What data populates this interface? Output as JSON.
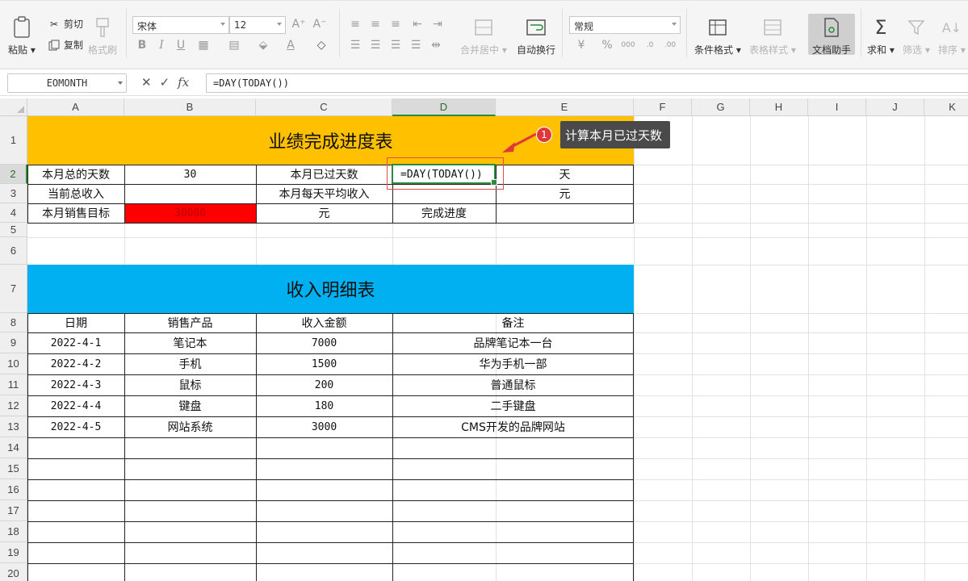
{
  "ribbon": {
    "clipboard": {
      "paste": "粘贴",
      "cut": "剪切",
      "copy": "复制",
      "format_painter": "格式刷"
    },
    "font": {
      "name": "宋体",
      "size": "12",
      "bold": "B",
      "italic": "I",
      "underline": "U"
    },
    "merge_center": "合并居中",
    "wrap_text": "自动换行",
    "number_format": "常规",
    "conditional_format": "条件格式",
    "table_style": "表格样式",
    "doc_assistant": "文档助手",
    "sum": "求和",
    "filter": "筛选",
    "sort": "排序"
  },
  "formula_bar": {
    "name_box": "EOMONTH",
    "fx_label": "fx",
    "formula": "=DAY(TODAY())"
  },
  "columns": [
    "A",
    "B",
    "C",
    "D",
    "E",
    "F",
    "G",
    "H",
    "I",
    "J",
    "K"
  ],
  "rows": [
    "1",
    "2",
    "3",
    "4",
    "5",
    "6",
    "7",
    "8",
    "9",
    "10",
    "11",
    "12",
    "13",
    "14",
    "15",
    "16",
    "17",
    "18",
    "19",
    "20"
  ],
  "sheet": {
    "title1": "业绩完成进度表",
    "r2": {
      "a": "本月总的天数",
      "b": "30",
      "c": "本月已过天数",
      "d": "=DAY(TODAY())",
      "e": "天"
    },
    "r3": {
      "a": "当前总收入",
      "c": "本月每天平均收入",
      "e": "元"
    },
    "r4": {
      "a": "本月销售目标",
      "b": "30000",
      "c": "元",
      "d": "完成进度"
    },
    "title2": "收入明细表",
    "detail_headers": [
      "日期",
      "销售产品",
      "收入金额",
      "备注"
    ],
    "detail_rows": [
      {
        "date": "2022-4-1",
        "product": "笔记本",
        "amount": "7000",
        "note": "品牌笔记本一台"
      },
      {
        "date": "2022-4-2",
        "product": "手机",
        "amount": "1500",
        "note": "华为手机一部"
      },
      {
        "date": "2022-4-3",
        "product": "鼠标",
        "amount": "200",
        "note": "普通鼠标"
      },
      {
        "date": "2022-4-4",
        "product": "键盘",
        "amount": "180",
        "note": "二手键盘"
      },
      {
        "date": "2022-4-5",
        "product": "网站系统",
        "amount": "3000",
        "note": "CMS开发的品牌网站"
      }
    ]
  },
  "annotation": {
    "badge": "1",
    "text": "计算本月已过天数"
  },
  "colors": {
    "banner_gold": "#FFC000",
    "banner_blue": "#00B0F0",
    "target_red": "#FF0000",
    "active_green": "#2E8B3E"
  }
}
